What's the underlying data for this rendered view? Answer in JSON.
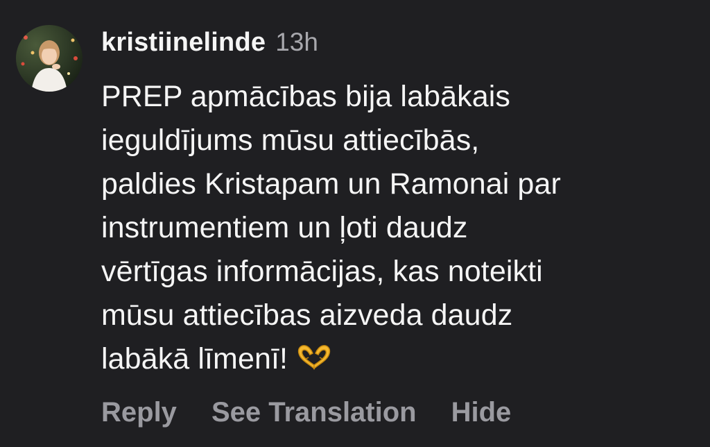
{
  "comment": {
    "username": "kristiinelinde",
    "timestamp": "13h",
    "text_lines": [
      "PREP apmācības bija labākais",
      "ieguldījums mūsu attiecībās,",
      "paldies Kristapam un Ramonai par",
      "instrumentiem un ļoti daudz",
      "vērtīgas informācijas, kas noteikti",
      "mūsu attiecības aizveda daudz",
      "labākā līmenī!"
    ],
    "emoji": "heart-hands-icon",
    "avatar": "avatar-photo"
  },
  "actions": {
    "reply_label": "Reply",
    "translate_label": "See Translation",
    "hide_label": "Hide"
  },
  "colors": {
    "background": "#1f1f22",
    "primary_text": "#f5f5f5",
    "secondary_text": "#a8a8ad",
    "action_text": "#9a9aa0",
    "emoji": "#f5b82e"
  }
}
